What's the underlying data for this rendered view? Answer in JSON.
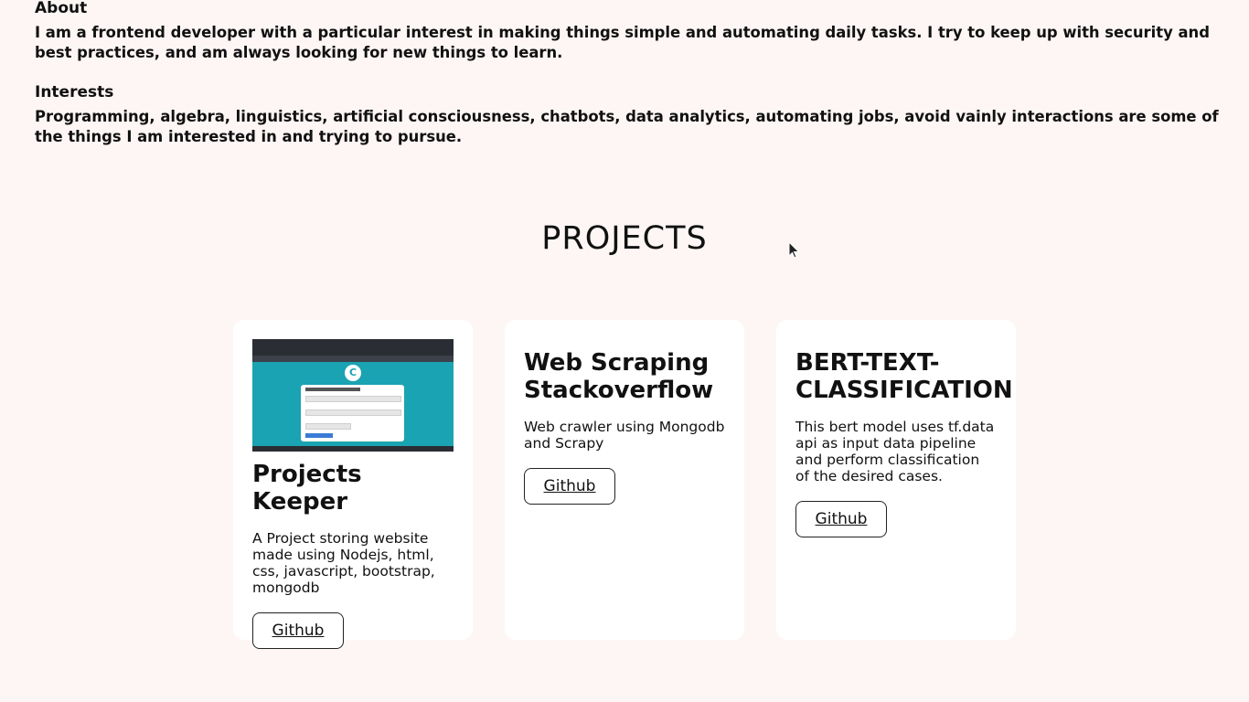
{
  "about": {
    "heading": "About",
    "text": "I am a frontend developer with a particular interest in making things simple and automating daily tasks. I try to keep up with security and best practices, and am always looking for new things to learn."
  },
  "interests": {
    "heading": "Interests",
    "text": "Programming, algebra, linguistics, artificial consciousness, chatbots, data analytics, automating jobs, avoid vainly interactions are some of the things I am interested in and trying to pursue."
  },
  "projects": {
    "title": "PROJECTS",
    "items": [
      {
        "title": "Projects Keeper",
        "description": "A Project storing website made using Nodejs, html, css, javascript, bootstrap, mongodb",
        "link_label": "Github"
      },
      {
        "title": "Web Scraping Stackoverflow",
        "description": "Web crawler using Mongodb and Scrapy",
        "link_label": "Github"
      },
      {
        "title": "BERT-TEXT-CLASSIFICATION",
        "description": "This bert model uses tf.data api as input data pipeline and perform classification of the desired cases.",
        "link_label": "Github"
      }
    ]
  },
  "colors": {
    "page_background": "#fdf6f5",
    "card_background": "#ffffff",
    "thumbnail_teal": "#1aa3b3"
  }
}
